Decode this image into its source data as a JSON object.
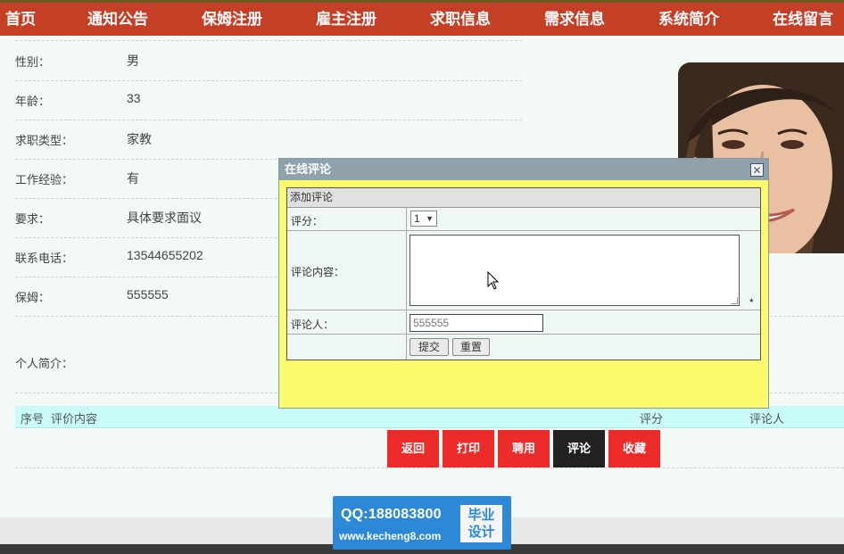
{
  "nav": {
    "items": [
      "首页",
      "通知公告",
      "保姆注册",
      "雇主注册",
      "求职信息",
      "需求信息",
      "系统简介",
      "在线留言"
    ]
  },
  "details": [
    {
      "label": "性别：",
      "value": "男"
    },
    {
      "label": "年龄：",
      "value": "33"
    },
    {
      "label": "求职类型：",
      "value": "家教"
    },
    {
      "label": "工作经验：",
      "value": "有"
    },
    {
      "label": "要求：",
      "value": "具体要求面议"
    },
    {
      "label": "联系电话：",
      "value": "13544655202"
    },
    {
      "label": "保姆：",
      "value": "555555"
    }
  ],
  "intro_label": "个人简介：",
  "comments_table": {
    "columns": [
      "序号",
      "评价内容",
      "评分",
      "评论人"
    ]
  },
  "actions": [
    "返回",
    "打印",
    "聘用",
    "评论",
    "收藏"
  ],
  "dialog": {
    "title": "在线评论",
    "close_symbol": "✕",
    "section": "添加评论",
    "score_label": "评分：",
    "score_value": "1",
    "content_label": "评论内容：",
    "required_mark": "*",
    "commenter_label": "评论人：",
    "commenter_value": "555555",
    "submit": "提交",
    "reset": "重置"
  },
  "watermark": {
    "qq": "QQ:188083800",
    "url": "www.kecheng8.com",
    "box_line1": "毕业",
    "box_line2": "设计"
  },
  "colors": {
    "nav": "#c53e26",
    "action_button": "#ee2b2b",
    "action_active": "#222222",
    "dialog_bg": "#fafa6a",
    "table_header": "#c9fbfb"
  }
}
